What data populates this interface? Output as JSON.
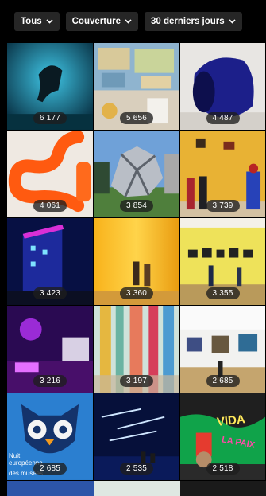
{
  "filters": [
    {
      "label": "Tous"
    },
    {
      "label": "Couverture"
    },
    {
      "label": "30 derniers jours"
    }
  ],
  "posts": [
    {
      "count": "6 177",
      "icon": "acrobat-performer-photo"
    },
    {
      "count": "5 656",
      "icon": "map-wall-gallery-photo"
    },
    {
      "count": "4 487",
      "icon": "blue-sculpture-photo"
    },
    {
      "count": "4 061",
      "icon": "orange-tube-sculpture-photo"
    },
    {
      "count": "3 854",
      "icon": "metal-sculpture-photo"
    },
    {
      "count": "3 739",
      "icon": "yellow-wall-artwork-photo"
    },
    {
      "count": "3 423",
      "icon": "night-building-photo"
    },
    {
      "count": "3 360",
      "icon": "yellow-curtain-installation-photo"
    },
    {
      "count": "3 355",
      "icon": "yellow-gallery-photo"
    },
    {
      "count": "3 216",
      "icon": "neon-room-photo"
    },
    {
      "count": "3 197",
      "icon": "colored-panels-photo"
    },
    {
      "count": "2 685",
      "icon": "white-gallery-photo"
    },
    {
      "count": "2 685",
      "icon": "owl-poster-photo"
    },
    {
      "count": "2 535",
      "icon": "light-installation-photo"
    },
    {
      "count": "2 518",
      "icon": "graffiti-wall-photo"
    }
  ],
  "poster": {
    "line1": "Nuit",
    "line2": "européenne",
    "line3": "des musées"
  },
  "graffiti": {
    "word1": "VIDA",
    "word2": "LA PAIX"
  }
}
